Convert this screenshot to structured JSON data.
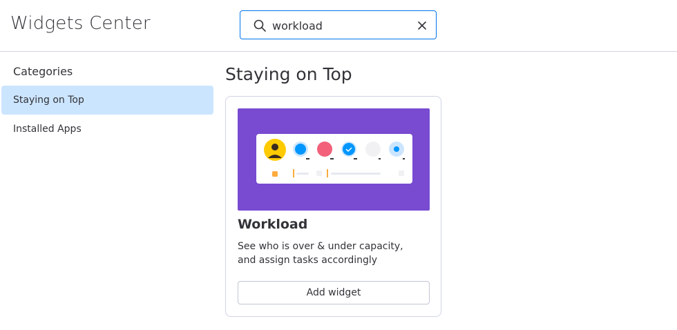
{
  "header": {
    "title": "Widgets Center"
  },
  "search": {
    "value": "workload",
    "placeholder": "Search"
  },
  "sidebar": {
    "heading": "Categories",
    "items": [
      {
        "label": "Staying on Top",
        "active": true
      },
      {
        "label": "Installed Apps",
        "active": false
      }
    ]
  },
  "main": {
    "section_title": "Staying on Top",
    "cards": [
      {
        "title": "Workload",
        "description": "See who is over & under capacity, and assign tasks accordingly",
        "button_label": "Add widget",
        "thumbnail_color": "#784bd1"
      }
    ]
  },
  "colors": {
    "accent": "#0073ea",
    "active_item_bg": "#cce5ff",
    "thumbnail_bg": "#784bd1"
  }
}
